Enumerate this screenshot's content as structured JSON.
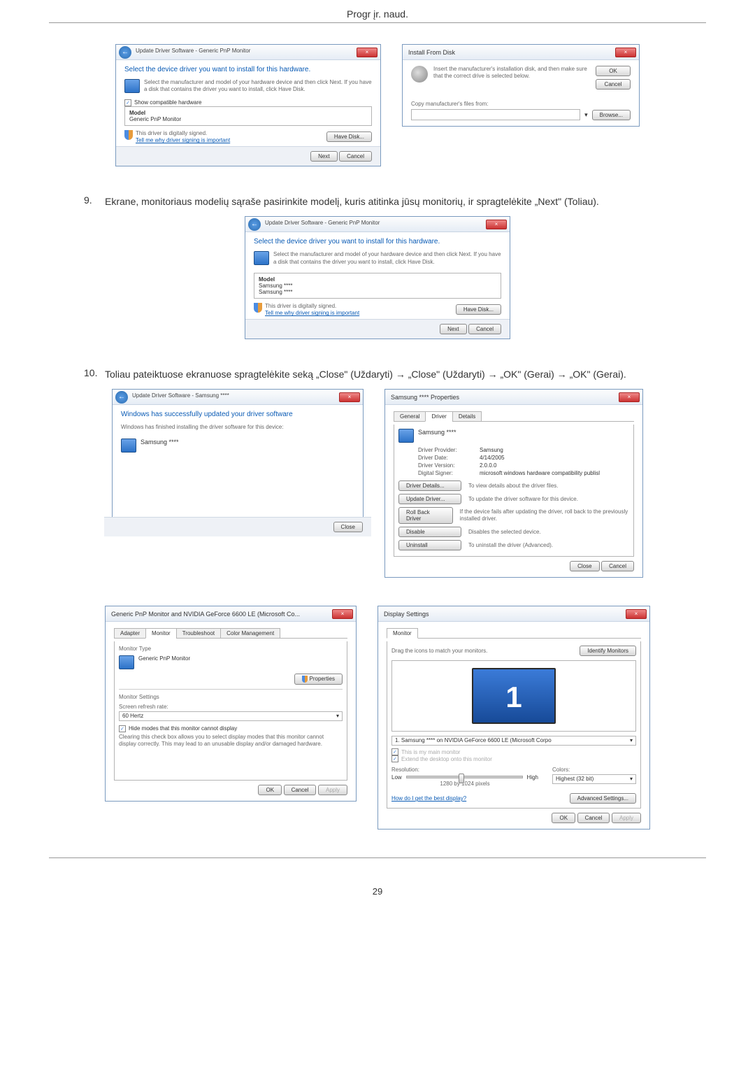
{
  "page_header": "Progr įr. naud.",
  "page_number": "29",
  "step9_num": "9.",
  "step9_text": "Ekrane, monitoriaus modelių sąraše pasirinkite modelį, kuris atitinka jūsų monitorių, ir spragtelėkite „Next\" (Toliau).",
  "step10_num": "10.",
  "step10_text": "Toliau pateiktuose ekranuose spragtelėkite seką „Close\" (Uždaryti) → „Close\" (Uždaryti) → „OK\" (Gerai) → „OK\" (Gerai).",
  "dlg1": {
    "breadcrumb": "Update Driver Software - Generic PnP Monitor",
    "heading": "Select the device driver you want to install for this hardware.",
    "desc": "Select the manufacturer and model of your hardware device and then click Next. If you have a disk that contains the driver you want to install, click Have Disk.",
    "chk_label": "Show compatible hardware",
    "list_hdr": "Model",
    "list_item": "Generic PnP Monitor",
    "signed": "This driver is digitally signed.",
    "signed_link": "Tell me why driver signing is important",
    "have_disk": "Have Disk...",
    "next": "Next",
    "cancel": "Cancel"
  },
  "dlg2": {
    "title": "Install From Disk",
    "prompt": "Insert the manufacturer's installation disk, and then make sure that the correct drive is selected below.",
    "ok": "OK",
    "cancel": "Cancel",
    "copy_from": "Copy manufacturer's files from:",
    "browse": "Browse..."
  },
  "dlg3": {
    "breadcrumb": "Update Driver Software - Generic PnP Monitor",
    "heading": "Select the device driver you want to install for this hardware.",
    "desc": "Select the manufacturer and model of your hardware device and then click Next. If you have a disk that contains the driver you want to install, click Have Disk.",
    "list_hdr": "Model",
    "list_item1": "Samsung ****",
    "list_item2": "Samsung ****",
    "signed": "This driver is digitally signed.",
    "signed_link": "Tell me why driver signing is important",
    "have_disk": "Have Disk...",
    "next": "Next",
    "cancel": "Cancel"
  },
  "dlg4": {
    "breadcrumb": "Update Driver Software - Samsung ****",
    "heading": "Windows has successfully updated your driver software",
    "desc": "Windows has finished installing the driver software for this device:",
    "device": "Samsung ****",
    "close": "Close"
  },
  "dlg5": {
    "title": "Samsung **** Properties",
    "tab_general": "General",
    "tab_driver": "Driver",
    "tab_details": "Details",
    "device_name": "Samsung ****",
    "provider_l": "Driver Provider:",
    "provider_v": "Samsung",
    "date_l": "Driver Date:",
    "date_v": "4/14/2005",
    "version_l": "Driver Version:",
    "version_v": "2.0.0.0",
    "signer_l": "Digital Signer:",
    "signer_v": "microsoft windows hardware compatibility publisl",
    "btn_details": "Driver Details...",
    "btn_details_d": "To view details about the driver files.",
    "btn_update": "Update Driver...",
    "btn_update_d": "To update the driver software for this device.",
    "btn_rollback": "Roll Back Driver",
    "btn_rollback_d": "If the device fails after updating the driver, roll back to the previously installed driver.",
    "btn_disable": "Disable",
    "btn_disable_d": "Disables the selected device.",
    "btn_uninstall": "Uninstall",
    "btn_uninstall_d": "To uninstall the driver (Advanced).",
    "close": "Close",
    "cancel": "Cancel"
  },
  "dlg6": {
    "title": "Generic PnP Monitor and NVIDIA GeForce 6600 LE (Microsoft Co...",
    "tab_adapter": "Adapter",
    "tab_monitor": "Monitor",
    "tab_troubleshoot": "Troubleshoot",
    "tab_color": "Color Management",
    "fs_type": "Monitor Type",
    "type_name": "Generic PnP Monitor",
    "properties": "Properties",
    "fs_settings": "Monitor Settings",
    "refresh_l": "Screen refresh rate:",
    "refresh_v": "60 Hertz",
    "chk_hide": "Hide modes that this monitor cannot display",
    "hide_desc": "Clearing this check box allows you to select display modes that this monitor cannot display correctly. This may lead to an unusable display and/or damaged hardware.",
    "ok": "OK",
    "cancel": "Cancel",
    "apply": "Apply"
  },
  "dlg7": {
    "title": "Display Settings",
    "tab_monitor": "Monitor",
    "drag": "Drag the icons to match your monitors.",
    "identify": "Identify Monitors",
    "monitor_num": "1",
    "dropdown": "1. Samsung **** on NVIDIA GeForce 6600 LE (Microsoft Corpo",
    "chk_main": "This is my main monitor",
    "chk_extend": "Extend the desktop onto this monitor",
    "res_l": "Resolution:",
    "low": "Low",
    "high": "High",
    "res_v": "1280 by 1024 pixels",
    "col_l": "Colors:",
    "col_v": "Highest (32 bit)",
    "help_link": "How do I get the best display?",
    "adv": "Advanced Settings...",
    "ok": "OK",
    "cancel": "Cancel",
    "apply": "Apply"
  }
}
